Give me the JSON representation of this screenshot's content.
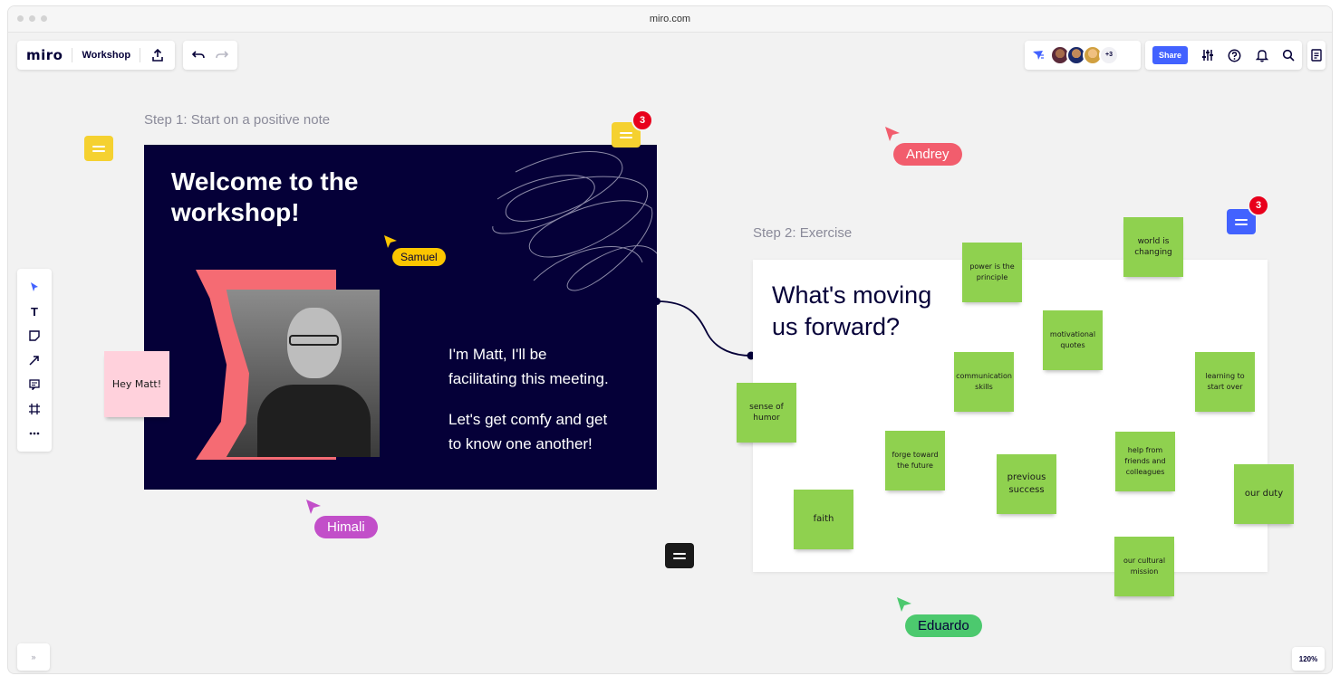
{
  "browser": {
    "url": "miro.com"
  },
  "topbar": {
    "logo": "miro",
    "board_name": "Workshop",
    "extra_collaborators": "+3",
    "share_label": "Share"
  },
  "frames": [
    {
      "title": "Step 1: Start on a positive note"
    },
    {
      "title": "Step 2: Exercise"
    }
  ],
  "welcome": {
    "heading_line1": "Welcome to the",
    "heading_line2": "workshop!",
    "intro_line1": "I'm Matt, I'll be",
    "intro_line2": "facilitating this meeting.",
    "intro_line3": "Let's get comfy and get",
    "intro_line4": "to know one another!"
  },
  "pink_note": "Hey Matt!",
  "exercise": {
    "heading_line1": "What's moving",
    "heading_line2": "us forward?"
  },
  "stickies": [
    {
      "l1": "power is the",
      "l2": "principle"
    },
    {
      "l1": "world is",
      "l2": "changing"
    },
    {
      "l1": "motivational",
      "l2": "quotes"
    },
    {
      "l1": "communication",
      "l2": "skills"
    },
    {
      "l1": "learning to",
      "l2": "start over"
    },
    {
      "l1": "sense of",
      "l2": "humor"
    },
    {
      "l1": "forge toward",
      "l2": "the future"
    },
    {
      "l1": "previous",
      "l2": "success"
    },
    {
      "l1": "help from",
      "l2": "friends and",
      "l3": "colleagues"
    },
    {
      "l1": "our duty"
    },
    {
      "l1": "faith"
    },
    {
      "l1": "our cultural",
      "l2": "mission"
    }
  ],
  "cursors": {
    "samuel": "Samuel",
    "andrey": "Andrey",
    "himali": "Himali",
    "eduardo": "Eduardo"
  },
  "badges": {
    "comment1": "3",
    "comment2": "3"
  },
  "zoom": "120%",
  "colors": {
    "brand_dark": "#050038",
    "accent_blue": "#4262ff",
    "sticky_green": "#8fd14f",
    "sticky_pink": "#ffd1dc",
    "coral": "#f56b73",
    "andrey": "#f25d6d",
    "himali": "#c24fc9",
    "eduardo": "#4cc96e",
    "samuel": "#fcc600"
  }
}
